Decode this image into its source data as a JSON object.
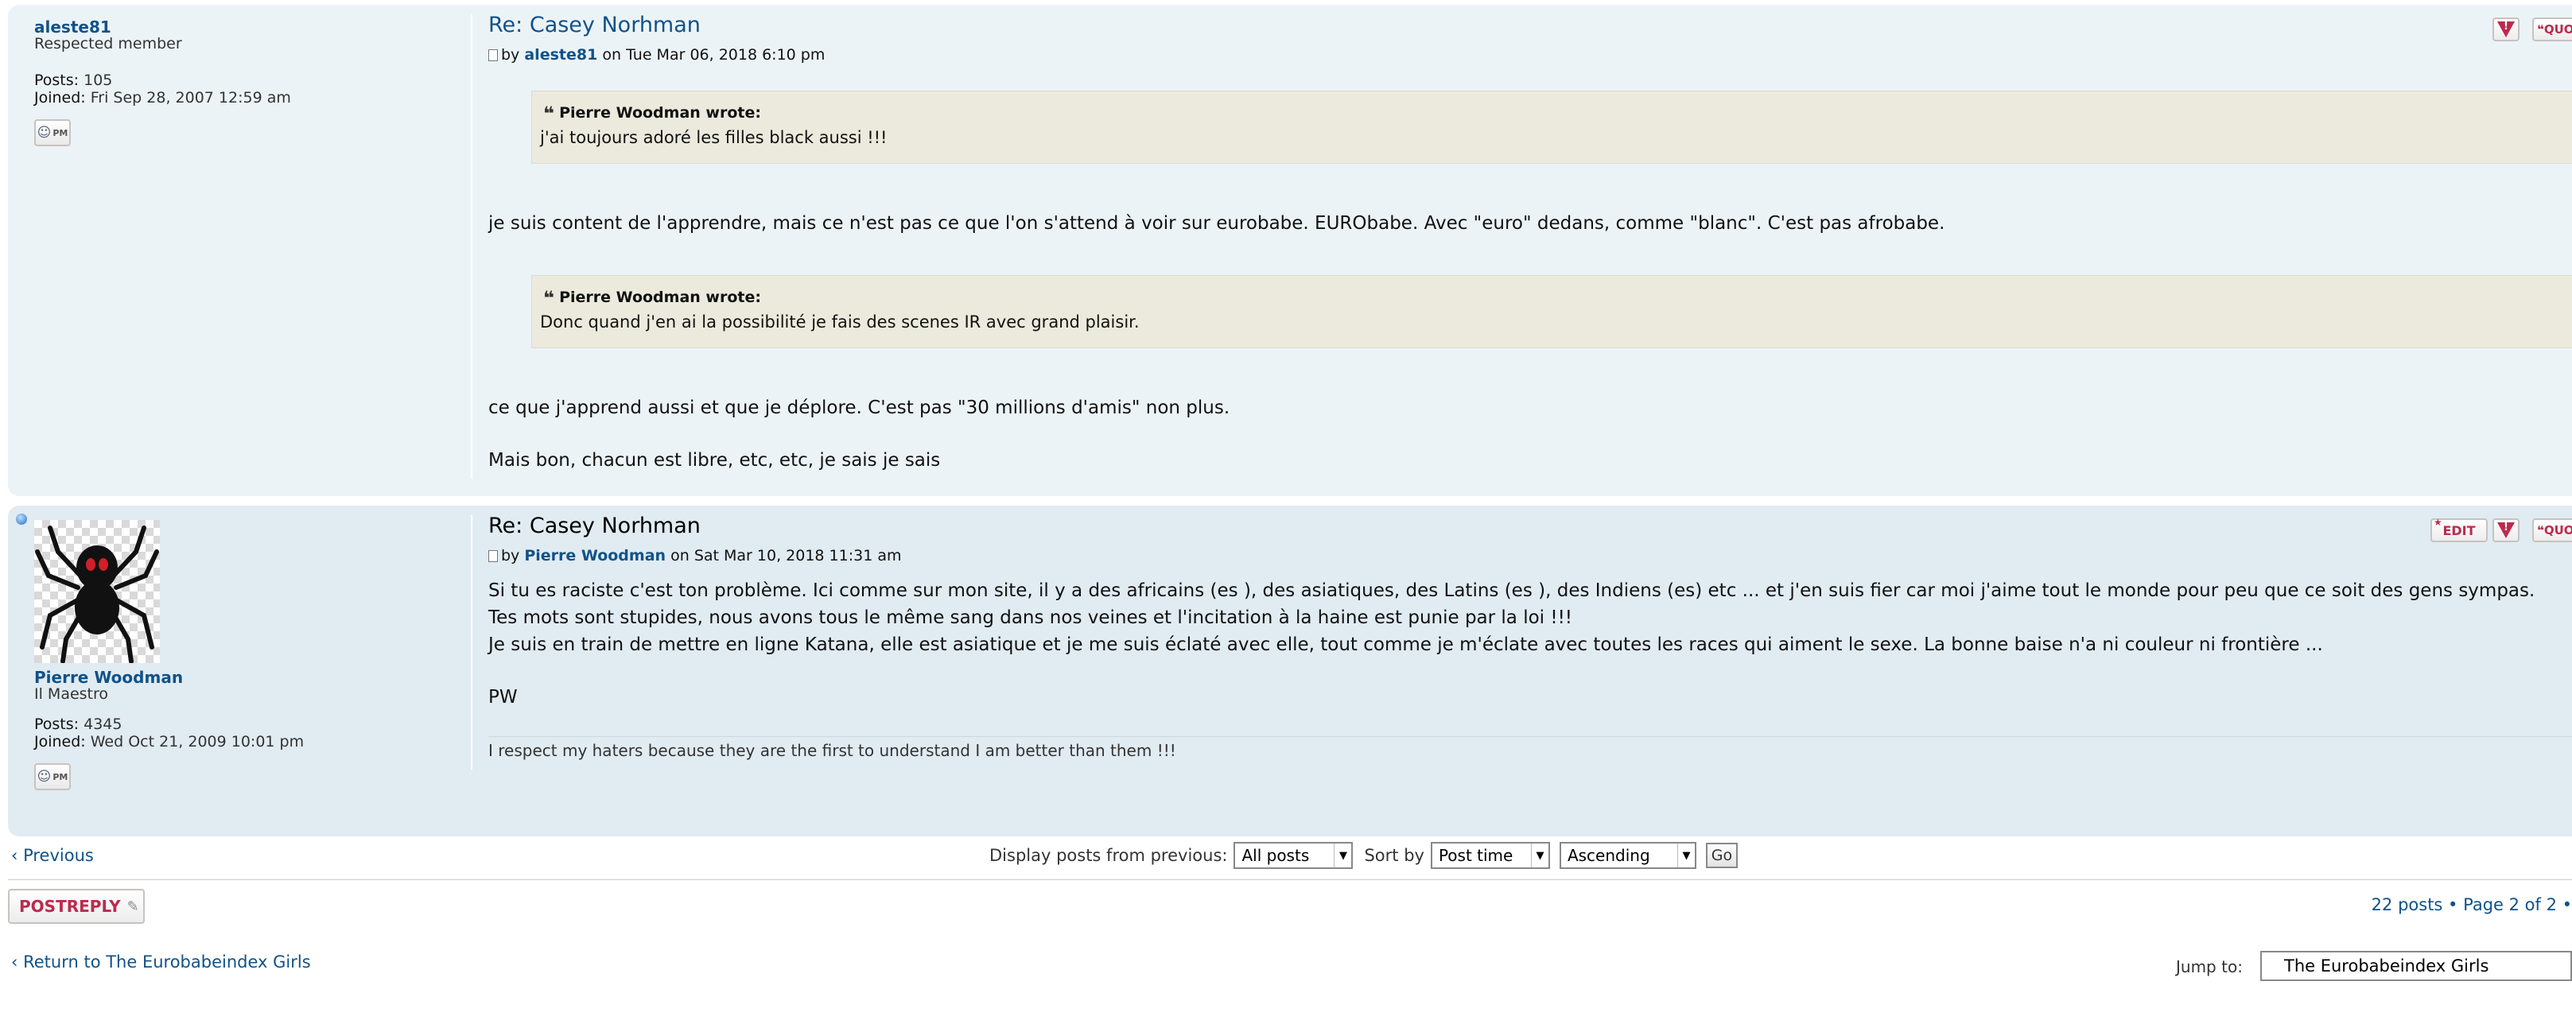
{
  "posts": [
    {
      "username": "aleste81",
      "rank": "Respected member",
      "posts_label": "Posts:",
      "posts_value": "105",
      "joined_label": "Joined:",
      "joined_value": "Fri Sep 28, 2007 12:59 am",
      "pm_label": "PM",
      "title": "Re: Casey Norhman",
      "by_prefix": "by",
      "author": "aleste81",
      "date": "on Tue Mar 06, 2018 6:10 pm",
      "quote1_cite": "Pierre Woodman wrote:",
      "quote1_text": "j'ai toujours adoré les filles black aussi !!!",
      "text1": "je suis content de l'apprendre, mais ce n'est pas ce que l'on s'attend à voir sur eurobabe. EURObabe. Avec \"euro\" dedans, comme \"blanc\". C'est pas afrobabe.",
      "quote2_cite": "Pierre Woodman wrote:",
      "quote2_text": "Donc quand j'en ai la possibilité je fais des scenes IR avec grand plaisir.",
      "text2": "ce que j'apprend aussi et que je déplore. C'est pas \"30 millions d'amis\" non plus.",
      "text3": "Mais bon, chacun est libre, etc, etc, je sais je sais"
    },
    {
      "username": "Pierre Woodman",
      "rank": "Il Maestro",
      "posts_label": "Posts:",
      "posts_value": "4345",
      "joined_label": "Joined:",
      "joined_value": "Wed Oct 21, 2009 10:01 pm",
      "pm_label": "PM",
      "title": "Re: Casey Norhman",
      "by_prefix": "by",
      "author": "Pierre Woodman",
      "date": "on Sat Mar 10, 2018 11:31 am",
      "line1": "Si tu es raciste c'est ton problème. Ici comme sur mon site, il y a des africains (es ), des asiatiques, des Latins (es ), des Indiens (es) etc ... et j'en suis fier car moi j'aime tout le monde pour peu que ce soit des gens sympas.",
      "line2": "Tes mots sont stupides, nous avons tous le même sang dans nos veines et l'incitation à la haine est punie par la loi !!!",
      "line3": "Je suis en train de mettre en ligne Katana, elle est asiatique et je me suis éclaté avec elle, tout comme je m'éclate avec toutes les races qui aiment le sexe. La bonne baise n'a ni couleur ni frontière ...",
      "line4": "PW",
      "signature": "I respect my haters because they are the first to understand I am better than them !!!",
      "edit_label": "EDIT"
    }
  ],
  "actions": {
    "quote_label": "QUOTE"
  },
  "footer": {
    "previous": "Previous",
    "display_label": "Display posts from previous:",
    "display_value": "All posts",
    "sort_label": "Sort by",
    "sort_value": "Post time",
    "order_value": "Ascending",
    "go": "Go",
    "post_reply_a": "POST",
    "post_reply_b": "REPLY",
    "pagination": "22 posts • Page 2 of 2 •",
    "return_link": "Return to The Eurobabeindex Girls",
    "jump_label": "Jump to:",
    "jump_value": "The Eurobabeindex Girls"
  },
  "colors": {
    "link": "#105289",
    "button_red": "#bc2a4d",
    "post_bg1": "#e1ebf2",
    "post_bg2": "#ecf3f7",
    "quote_bg": "#ebeadd"
  }
}
